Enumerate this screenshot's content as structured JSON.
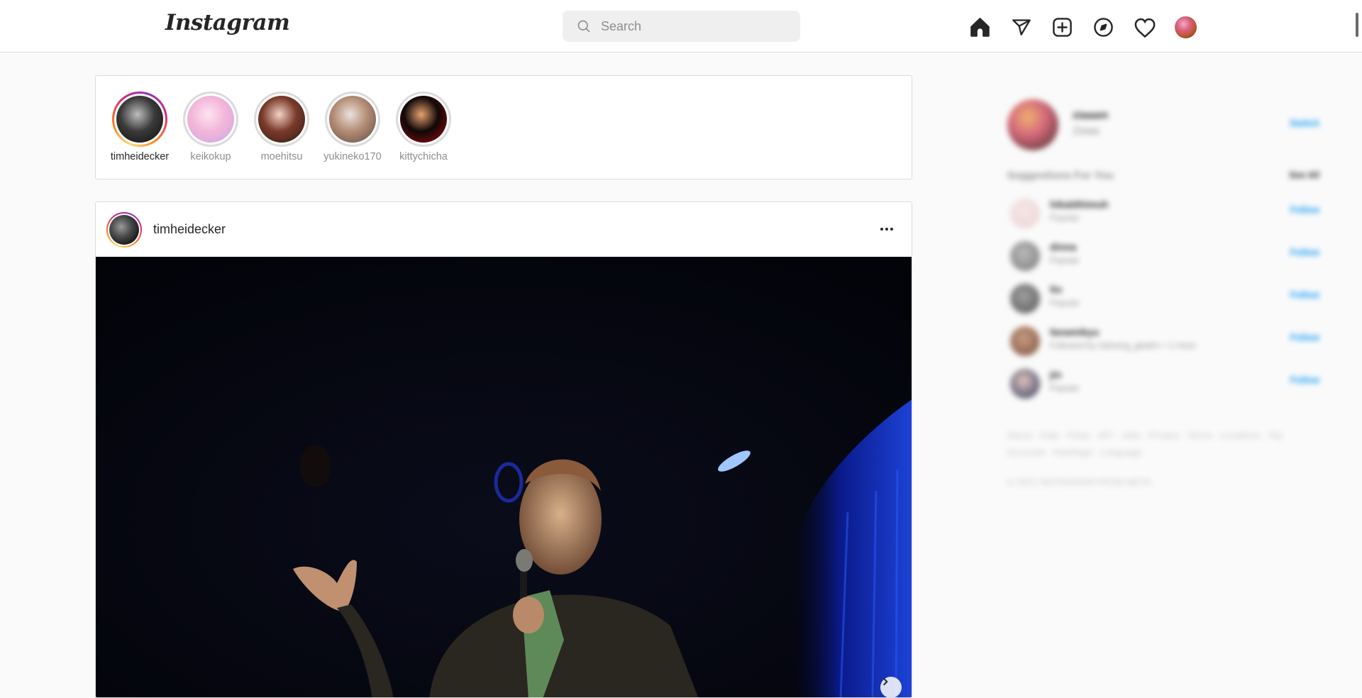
{
  "app": {
    "logo_text": "Instagram"
  },
  "header": {
    "search": {
      "placeholder": "Search",
      "value": ""
    },
    "nav_icons": [
      "home-icon",
      "direct-message-icon",
      "new-post-icon",
      "explore-icon",
      "activity-heart-icon",
      "profile-avatar"
    ]
  },
  "stories": [
    {
      "username": "timheidecker",
      "unseen": true,
      "avatar_colors": [
        "#bdbdbd",
        "#3a3a3a",
        "#0d0d0d"
      ]
    },
    {
      "username": "keikokup",
      "unseen": false,
      "avatar_colors": [
        "#fde4f2",
        "#f3b6d8",
        "#c9a6e8"
      ]
    },
    {
      "username": "moehitsu",
      "unseen": false,
      "avatar_colors": [
        "#f2d2c6",
        "#7a3a2a",
        "#2b1b17"
      ]
    },
    {
      "username": "yukineko170",
      "unseen": false,
      "avatar_colors": [
        "#e9e2dc",
        "#b48c74",
        "#5a4a44"
      ]
    },
    {
      "username": "kittychicha",
      "unseen": false,
      "avatar_colors": [
        "#e8a070",
        "#100808",
        "#a50d0d"
      ]
    }
  ],
  "post": {
    "author": "timheidecker",
    "more_options_icon": "more-horizontal-icon",
    "media_description": "Comedian on stage holding a microphone, dark venue with blue curtain lighting",
    "has_next": true
  },
  "sidebar": {
    "current_user": {
      "username": "ziaaam",
      "full_name": "Ziaaa",
      "switch_label": "Switch"
    },
    "suggestions_title": "Suggestions For You",
    "see_all_label": "See All",
    "suggestions": [
      {
        "username": "hikaldhimuh",
        "subtitle": "Popular",
        "follow_label": "Follow",
        "avatar_colors": [
          "#f6e6e6",
          "#e9d3d3"
        ]
      },
      {
        "username": "dinna",
        "subtitle": "Popular",
        "follow_label": "Follow",
        "avatar_colors": [
          "#bbbbbb",
          "#777777"
        ]
      },
      {
        "username": "fin",
        "subtitle": "Popular",
        "follow_label": "Follow",
        "avatar_colors": [
          "#a0a0a0",
          "#555555"
        ]
      },
      {
        "username": "fanamikyu",
        "subtitle": "Followed by nidnoing_gbalim + 1 more",
        "follow_label": "Follow",
        "avatar_colors": [
          "#c79a80",
          "#7b5340"
        ]
      },
      {
        "username": "jin",
        "subtitle": "Popular",
        "follow_label": "Follow",
        "avatar_colors": [
          "#e2c7c0",
          "#2a3458"
        ]
      }
    ],
    "footer_links": "About · Help · Press · API · Jobs · Privacy · Terms · Locations · Top Accounts · Hashtags · Language",
    "copyright": "© 2021 INSTAGRAM FROM META"
  }
}
